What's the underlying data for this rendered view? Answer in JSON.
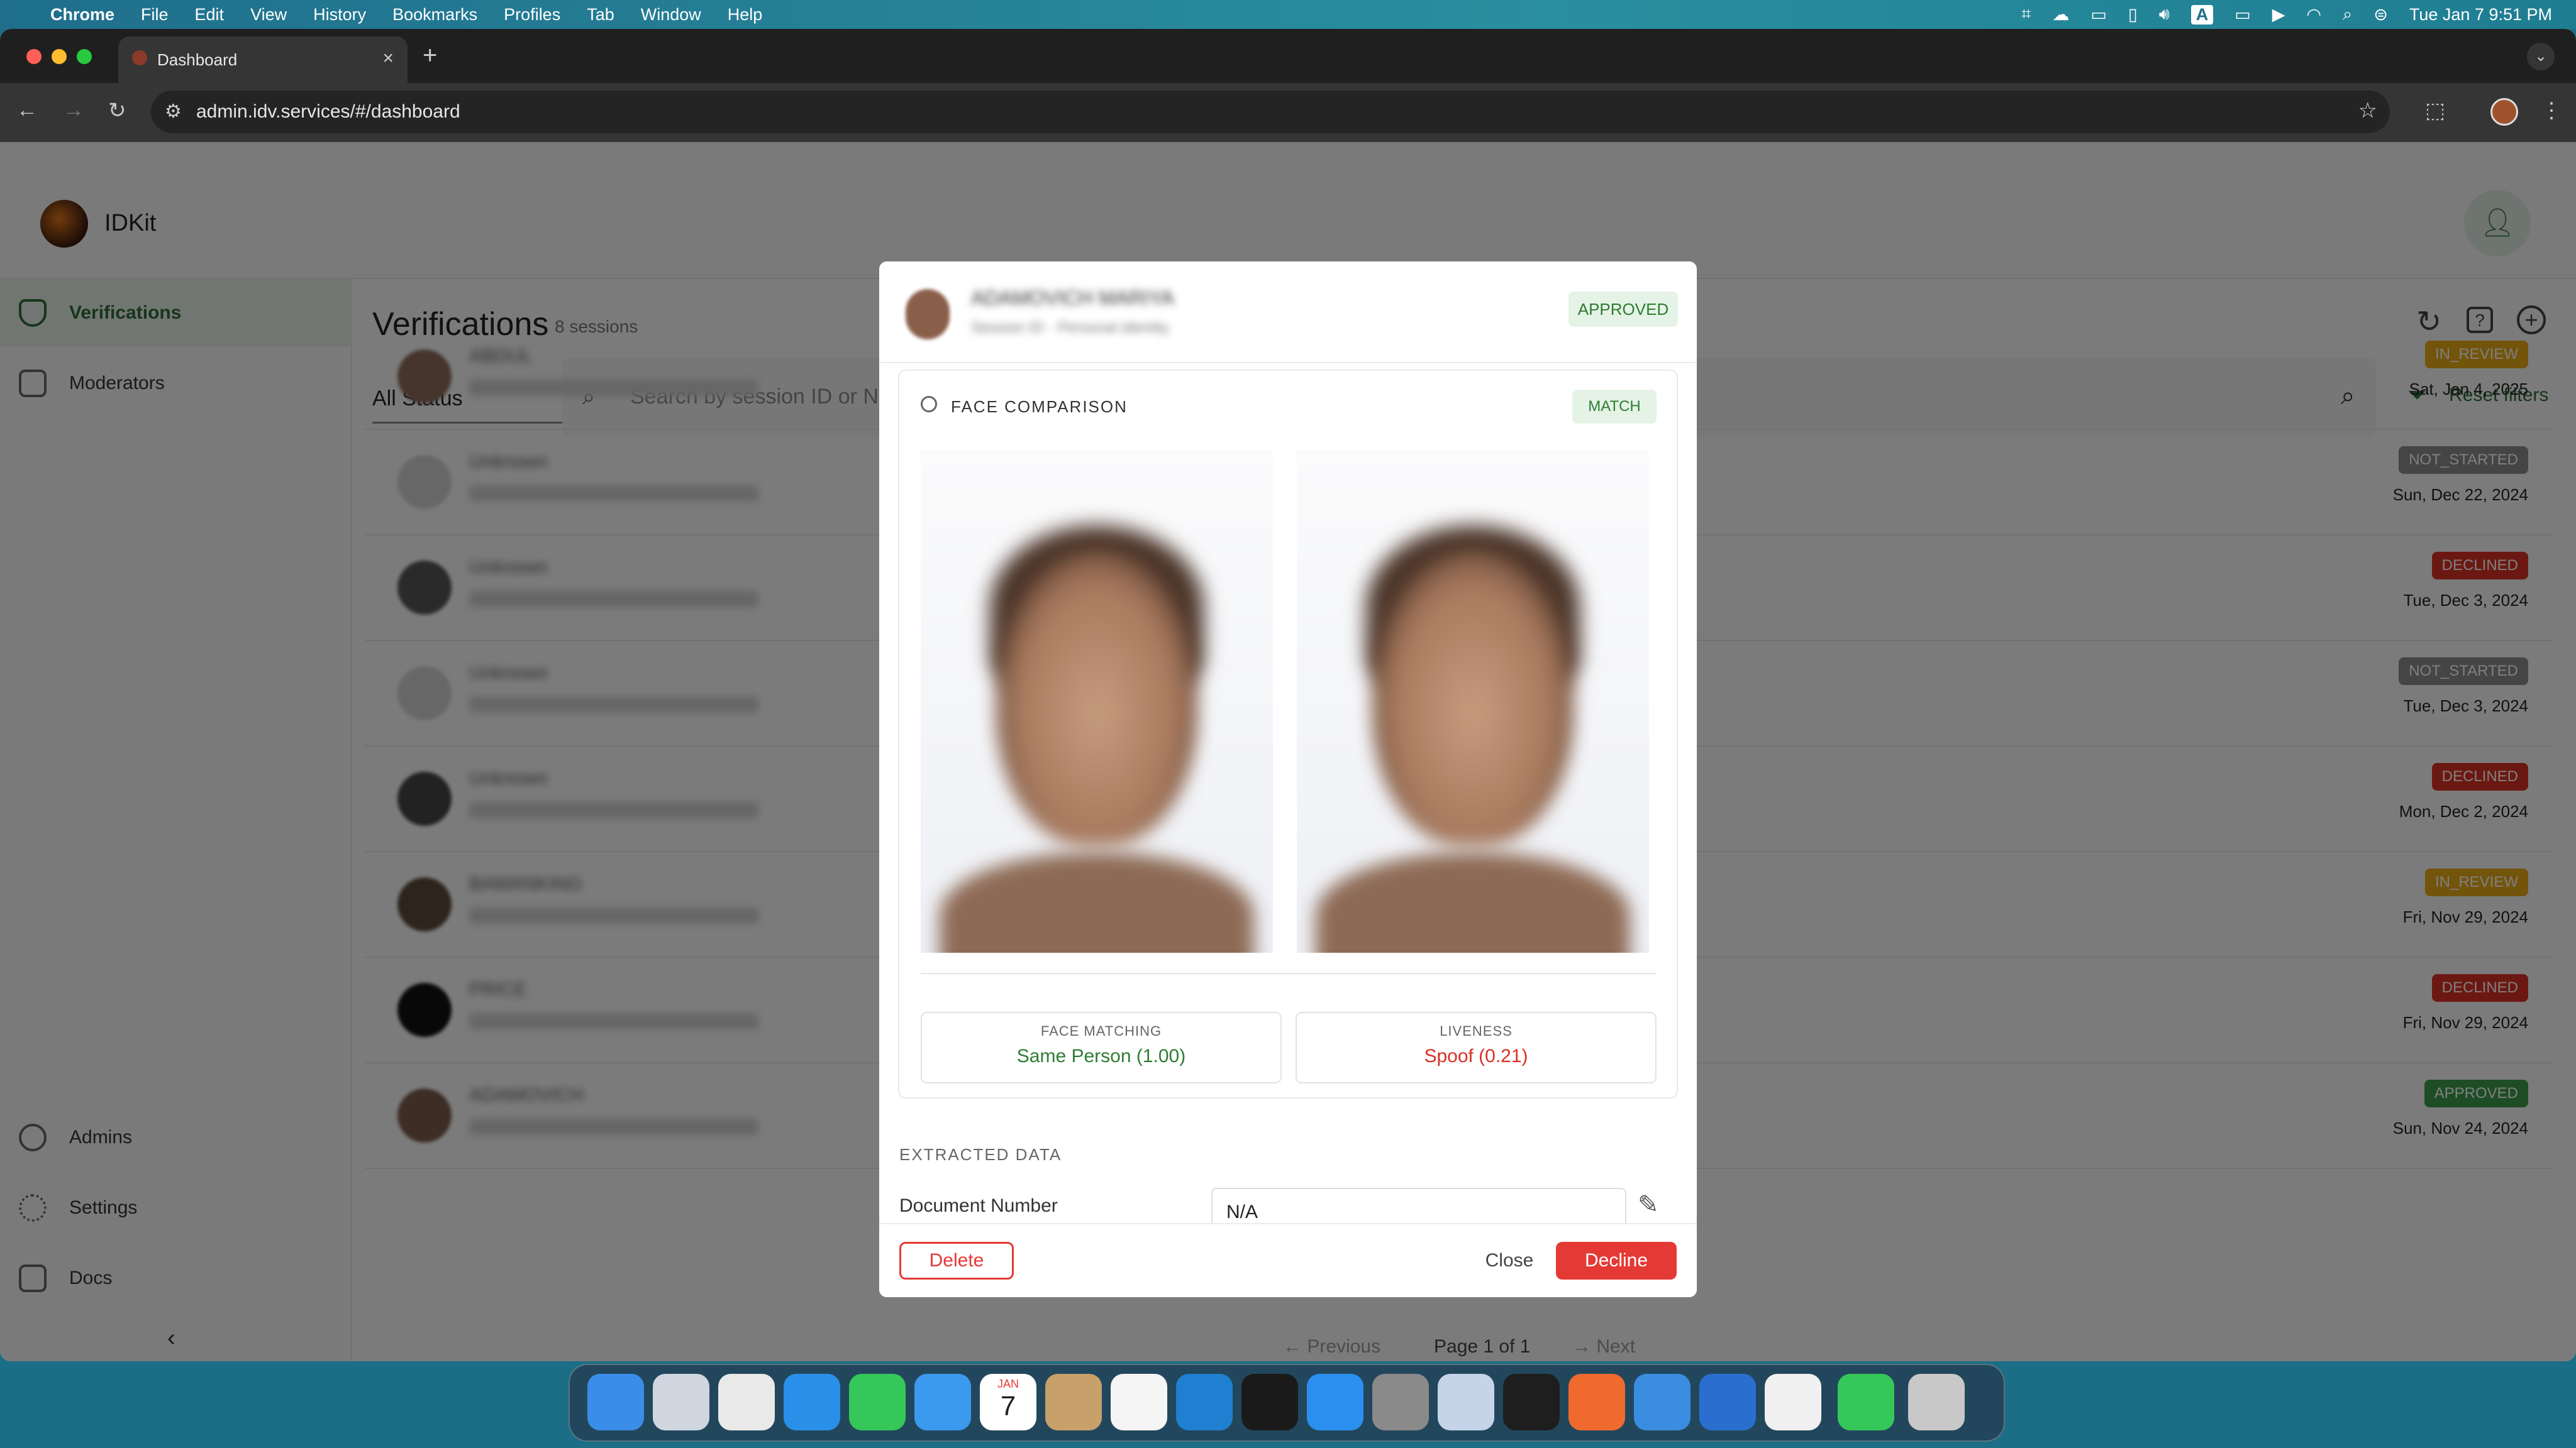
{
  "menubar": {
    "app": "Chrome",
    "items": [
      "File",
      "Edit",
      "View",
      "History",
      "Bookmarks",
      "Profiles",
      "Tab",
      "Window",
      "Help"
    ],
    "status_letter": "A",
    "clock": "Tue Jan 7  9:51 PM"
  },
  "browser": {
    "tab_title": "Dashboard",
    "url": "admin.idv.services/#/dashboard"
  },
  "app": {
    "name": "IDKit",
    "page_title": "Verifications",
    "session_count": "8 sessions",
    "status_filter": "All Status",
    "search_placeholder": "Search by session ID or Na",
    "reset_filters": "Reset filters",
    "sidebar": {
      "verifications": "Verifications",
      "moderators": "Moderators",
      "admins": "Admins",
      "settings": "Settings",
      "docs": "Docs"
    },
    "rows": [
      {
        "name": "ABDUL",
        "status": "IN_REVIEW",
        "date": "Sat, Jan 4, 2025",
        "color": "#e6a817"
      },
      {
        "name": "Unknown",
        "status": "NOT_STARTED",
        "date": "Sun, Dec 22, 2024",
        "color": "#8a8a8a"
      },
      {
        "name": "Unknown",
        "status": "DECLINED",
        "date": "Tue, Dec 3, 2024",
        "color": "#d93025"
      },
      {
        "name": "Unknown",
        "status": "NOT_STARTED",
        "date": "Tue, Dec 3, 2024",
        "color": "#8a8a8a"
      },
      {
        "name": "Unknown",
        "status": "DECLINED",
        "date": "Mon, Dec 2, 2024",
        "color": "#d93025"
      },
      {
        "name": "BAMANKING",
        "status": "IN_REVIEW",
        "date": "Fri, Nov 29, 2024",
        "color": "#e6a817"
      },
      {
        "name": "PRICE",
        "status": "DECLINED",
        "date": "Fri, Nov 29, 2024",
        "color": "#d93025"
      },
      {
        "name": "ADAMOVICH",
        "status": "APPROVED",
        "date": "Sun, Nov 24, 2024",
        "color": "#3d9a4a"
      }
    ],
    "pagination": {
      "previous": "Previous",
      "page": "Page 1 of 1",
      "next": "Next"
    }
  },
  "modal": {
    "person_name": "ADAMOVICH MARIYA",
    "person_sub": "Session ID · Personal identity",
    "status": "APPROVED",
    "section_title": "FACE COMPARISON",
    "match_badge": "MATCH",
    "face_matching_label": "FACE MATCHING",
    "face_matching_value": "Same Person (1.00)",
    "liveness_label": "LIVENESS",
    "liveness_value": "Spoof (0.21)",
    "extracted_title": "EXTRACTED DATA",
    "doc_number_label": "Document Number",
    "doc_number_value": "N/A",
    "delete": "Delete",
    "close": "Close",
    "decline": "Decline"
  },
  "colors": {
    "accent_green": "#2e7d32",
    "decline_red": "#e53935"
  },
  "dock_icons": [
    "finder-icon",
    "launchpad-icon",
    "chrome-icon",
    "safari-icon",
    "messages-icon",
    "mail-icon",
    "calendar-icon",
    "contacts-icon",
    "reminders-icon",
    "vscode-icon",
    "terminal-icon",
    "appstore-icon",
    "settings-icon",
    "iphone-mirror-icon",
    "figma-icon",
    "pen-icon",
    "xcode-icon",
    "instruments-icon",
    "preview-icon",
    "facetime-icon",
    "trash-icon"
  ],
  "calendar_day": "7",
  "calendar_month": "JAN"
}
